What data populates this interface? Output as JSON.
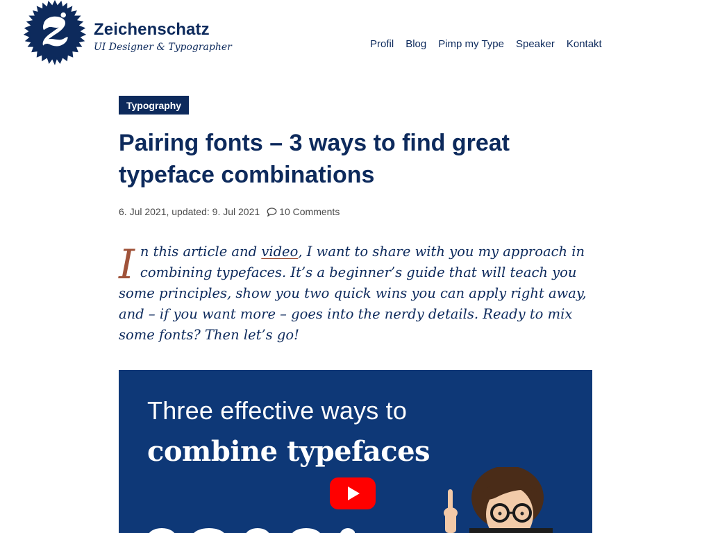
{
  "header": {
    "site_title": "Zeichenschatz",
    "tagline": "UI Designer & Typographer",
    "logo_icon": "z-badge-icon",
    "nav": [
      {
        "label": "Profil"
      },
      {
        "label": "Blog"
      },
      {
        "label": "Pimp my Type"
      },
      {
        "label": "Speaker"
      },
      {
        "label": "Kontakt"
      }
    ]
  },
  "article": {
    "category": "Typography",
    "title": "Pairing fonts – 3 ways to find great typeface combinations",
    "meta_date": "6. Jul 2021, updated: 9. Jul 2021",
    "comments": "10 Comments",
    "comments_icon": "speech-bubble-icon",
    "intro": {
      "drop_cap": "I",
      "before_link": "n this article and ",
      "link_text": "video",
      "after_link": ", I want to share with you my approach in combining typefaces. It’s a beginner’s guide that will teach you some principles, show you two quick wins you can apply right away, and – if you want more – goes into the nerdy details. Ready to mix some fonts? Then let’s go!"
    },
    "video": {
      "line1": "Three effective ways to",
      "line2": "combine typefaces",
      "play_icon": "youtube-play-icon"
    }
  },
  "colors": {
    "navy": "#0d2a5c",
    "video_bg": "#0e3877",
    "accent": "#a0533a",
    "youtube_red": "#ff0000"
  }
}
